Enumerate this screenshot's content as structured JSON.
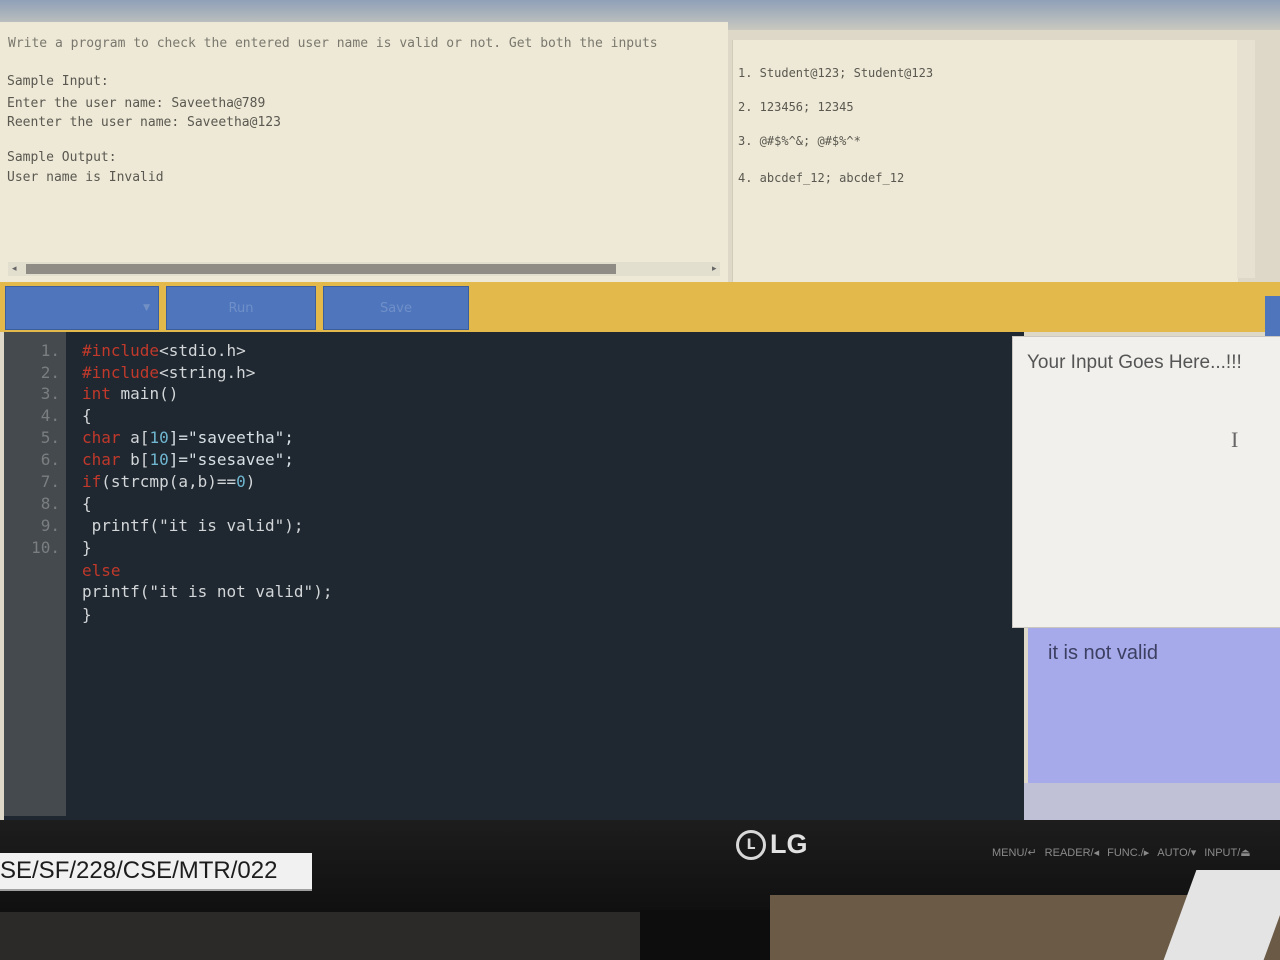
{
  "problem": {
    "statement": "Write a program to check the entered user name is valid or not. Get both the inputs",
    "sample_input_heading": "Sample Input:",
    "sample_input_lines": [
      "Enter the user name: Saveetha@789",
      "Reenter the user name: Saveetha@123"
    ],
    "sample_output_heading": "Sample Output:",
    "sample_output_line": "User name is Invalid"
  },
  "test_cases": [
    "1. Student@123; Student@123",
    "2. 123456; 12345",
    "3. @#$%^&; @#$%^*",
    "4. abcdef_12; abcdef_12"
  ],
  "toolbar": {
    "run_label": "Run",
    "save_label": "Save"
  },
  "editor": {
    "line_numbers": [
      "1.",
      "2.",
      "3.",
      "4.",
      "5.",
      "6.",
      "7.",
      "8.",
      "9.",
      "10."
    ],
    "code": {
      "l1_pre": "#include",
      "l1_hdr": "<stdio.h>",
      "l2_pre": "#include",
      "l2_hdr": "<string.h>",
      "l3_kw": "int",
      "l3_rest": " main()",
      "l4": "{",
      "l5_kw": "char",
      "l5_a": " a[",
      "l5_n": "10",
      "l5_b": "]=\"saveetha\";",
      "l6_kw": "char",
      "l6_a": " b[",
      "l6_n": "10",
      "l6_b": "]=\"ssesavee\";",
      "l7_kw": "if",
      "l7_a": "(strcmp(a,b)==",
      "l7_n": "0",
      "l7_b": ")",
      "l8": "{",
      "l9": " printf(\"it is valid\");",
      "l10": "}",
      "l11_kw": "else",
      "l12": "printf(\"it is not valid\");",
      "l13": "}"
    }
  },
  "input_panel": {
    "placeholder": "Your Input Goes Here...!!!"
  },
  "output_panel": {
    "text": "it is not valid"
  },
  "monitor": {
    "brand": "LG",
    "controls": [
      "MENU/↵",
      "READER/◂",
      "FUNC./▸",
      "AUTO/▾",
      "INPUT/⏏"
    ],
    "asset_tag": "SE/SF/228/CSE/MTR/022"
  },
  "colors": {
    "toolbar": "#e3b94b",
    "button": "#4f76bd",
    "editor_bg": "#1f2730",
    "output_bg": "#a6aaea"
  }
}
